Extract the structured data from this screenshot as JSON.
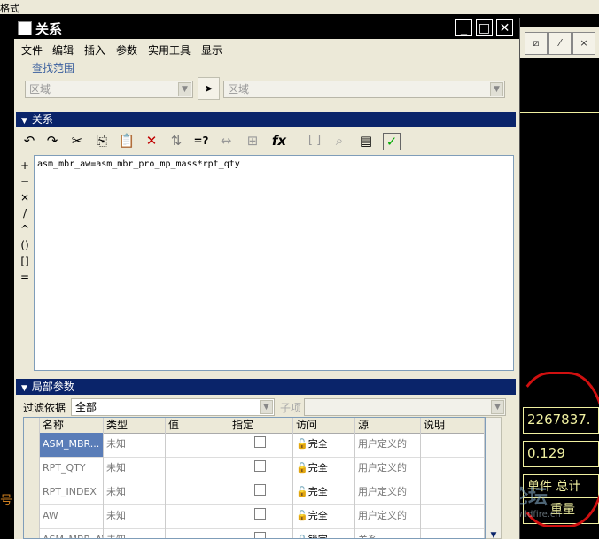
{
  "window": {
    "title": "关系",
    "min": "_",
    "max": "□",
    "close": "✕"
  },
  "menu": [
    "文件",
    "编辑",
    "插入",
    "参数",
    "实用工具",
    "显示"
  ],
  "search": {
    "label": "查找范围",
    "scope_value": "区域",
    "target_value": "区域"
  },
  "relations": {
    "section_title": "关系",
    "operators": [
      "+",
      "−",
      "×",
      "/",
      "^",
      "()",
      "[]",
      "="
    ],
    "text": "asm_mbr_aw=asm_mbr_pro_mp_mass*rpt_qty"
  },
  "toolbar": {
    "undo": "↶",
    "redo": "↷",
    "cut": "✂",
    "copy": "⎘",
    "paste": "📋",
    "delete": "✕",
    "sort": "⇅",
    "evaluate": "=?",
    "dimension": "↔",
    "function": "fx",
    "brackets": "[ ]",
    "verify": "✓"
  },
  "local_params": {
    "section_title": "局部参数",
    "filter_label": "过滤依据",
    "filter_value": "全部",
    "subitem_label": "子项",
    "columns": [
      "名称",
      "类型",
      "值",
      "指定",
      "访问",
      "源",
      "说明"
    ],
    "rows": [
      {
        "name": "ASM_MBR...",
        "type": "未知",
        "access": "完全",
        "source": "用户定义的"
      },
      {
        "name": "RPT_QTY",
        "type": "未知",
        "access": "完全",
        "source": "用户定义的"
      },
      {
        "name": "RPT_INDEX",
        "type": "未知",
        "access": "完全",
        "source": "用户定义的"
      },
      {
        "name": "AW",
        "type": "未知",
        "access": "完全",
        "source": "用户定义的"
      },
      {
        "name": "ASM_MBR_AW",
        "type": "未知",
        "access": "锁定",
        "source": "关系"
      }
    ]
  },
  "background": {
    "top_fragment": "格式",
    "cell_1": "2267837.",
    "cell_2": "0.129",
    "cell_3": "单件 总计",
    "cell_4": "重量",
    "left_fragment": "号",
    "watermark_text": "野火论坛",
    "watermark_url": "www.proewildfire.cn"
  }
}
